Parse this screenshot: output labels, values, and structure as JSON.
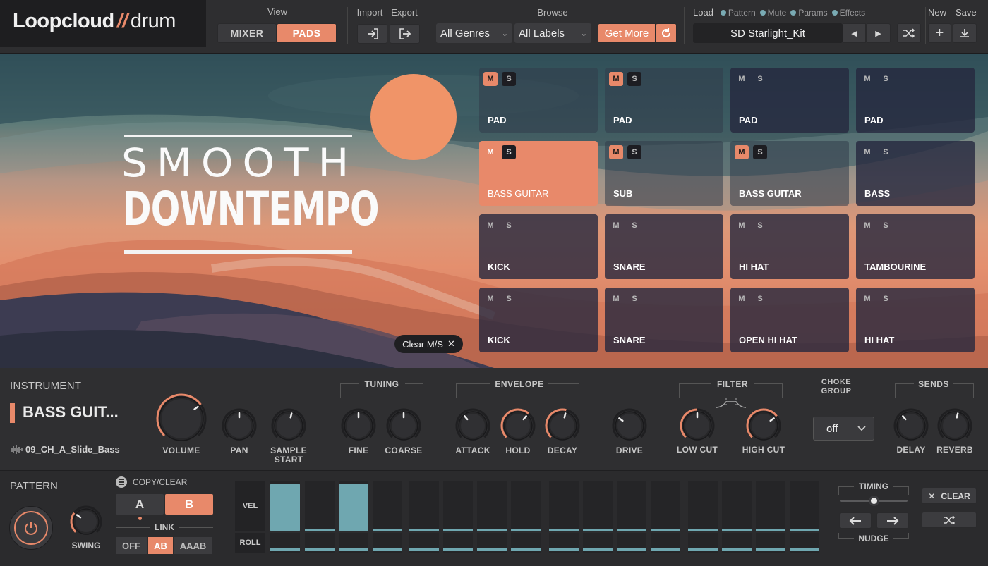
{
  "app": {
    "logo_main": "Loopcloud",
    "logo_slash": "//",
    "logo_sub": "drum"
  },
  "top": {
    "view_label": "View",
    "mixer": "MIXER",
    "pads": "PADS",
    "import_label": "Import",
    "export_label": "Export",
    "browse_label": "Browse",
    "genre": "All Genres",
    "labels": "All Labels",
    "get_more": "Get More",
    "load_label": "Load",
    "load_opts": [
      "Pattern",
      "Mute",
      "Params",
      "Effects"
    ],
    "kit": "SD Starlight_Kit",
    "new_label": "New",
    "save_label": "Save"
  },
  "hero": {
    "title1": "SMOOTH",
    "title2": "DOWNTEMPO",
    "clear_ms": "Clear M/S"
  },
  "pads": [
    {
      "name": "PAD",
      "m": "M",
      "s": "S",
      "mute": true,
      "style": "light"
    },
    {
      "name": "PAD",
      "m": "M",
      "s": "S",
      "mute": true,
      "style": "light"
    },
    {
      "name": "PAD",
      "m": "M",
      "s": "S",
      "mute": false,
      "style": "dark"
    },
    {
      "name": "PAD",
      "m": "M",
      "s": "S",
      "mute": false,
      "style": "dark"
    },
    {
      "name": "BASS GUITAR",
      "m": "M",
      "s": "S",
      "mute": false,
      "style": "sel"
    },
    {
      "name": "SUB",
      "m": "M",
      "s": "S",
      "mute": true,
      "style": "light"
    },
    {
      "name": "BASS GUITAR",
      "m": "M",
      "s": "S",
      "mute": true,
      "style": "light"
    },
    {
      "name": "BASS",
      "m": "M",
      "s": "S",
      "mute": false,
      "style": "dark"
    },
    {
      "name": "KICK",
      "m": "M",
      "s": "S",
      "mute": false,
      "style": "dark"
    },
    {
      "name": "SNARE",
      "m": "M",
      "s": "S",
      "mute": false,
      "style": "dark"
    },
    {
      "name": "HI HAT",
      "m": "M",
      "s": "S",
      "mute": false,
      "style": "dark"
    },
    {
      "name": "TAMBOURINE",
      "m": "M",
      "s": "S",
      "mute": false,
      "style": "dark"
    },
    {
      "name": "KICK",
      "m": "M",
      "s": "S",
      "mute": false,
      "style": "dark"
    },
    {
      "name": "SNARE",
      "m": "M",
      "s": "S",
      "mute": false,
      "style": "dark"
    },
    {
      "name": "OPEN HI HAT",
      "m": "M",
      "s": "S",
      "mute": false,
      "style": "dark"
    },
    {
      "name": "HI HAT",
      "m": "M",
      "s": "S",
      "mute": false,
      "style": "dark"
    }
  ],
  "instrument": {
    "heading": "INSTRUMENT",
    "name": "BASS GUIT...",
    "sample": "09_CH_A_Slide_Bass",
    "tuning": "TUNING",
    "envelope": "ENVELOPE",
    "filter": "FILTER",
    "choke1": "CHOKE",
    "choke2": "GROUP",
    "sends": "SENDS",
    "choke_value": "off",
    "knobs": [
      {
        "label": "VOLUME",
        "value": 0.7
      },
      {
        "label": "PAN",
        "value": 0.5
      },
      {
        "label": "SAMPLE",
        "label2": "START",
        "value": 0.55
      },
      {
        "label": "FINE",
        "value": 0.5
      },
      {
        "label": "COARSE",
        "value": 0.5
      },
      {
        "label": "ATTACK",
        "value": 0.35
      },
      {
        "label": "HOLD",
        "value": 0.65
      },
      {
        "label": "DECAY",
        "value": 0.55
      },
      {
        "label": "DRIVE",
        "value": 0.3
      },
      {
        "label": "LOW CUT",
        "value": 0.5
      },
      {
        "label": "HIGH CUT",
        "value": 0.7
      },
      {
        "label": "DELAY",
        "value": 0.35
      },
      {
        "label": "REVERB",
        "value": 0.55
      }
    ]
  },
  "pattern": {
    "heading": "PATTERN",
    "copy_clear": "COPY/CLEAR",
    "a": "A",
    "b": "B",
    "link": "LINK",
    "link_opts": [
      "OFF",
      "AB",
      "AAAB"
    ],
    "swing": "SWING",
    "swing_value": 0.3,
    "vel": "VEL",
    "roll": "ROLL",
    "steps": [
      1,
      0,
      1,
      0,
      0,
      0,
      0,
      0,
      0,
      0,
      0,
      0,
      0,
      0,
      0,
      0
    ],
    "timing": "TIMING",
    "nudge": "NUDGE",
    "clear": "CLEAR",
    "timing_value": 0.5
  },
  "colors": {
    "accent": "#e8896a",
    "teal": "#6fa7b0"
  }
}
